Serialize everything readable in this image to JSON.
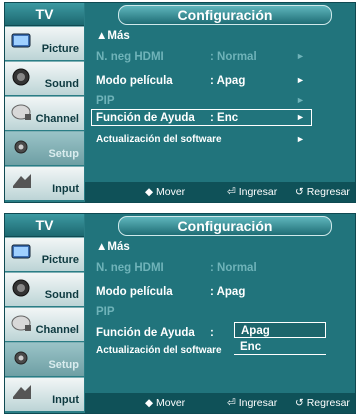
{
  "screens": [
    {
      "sidebar": {
        "header": "TV",
        "items": [
          {
            "label": "Picture",
            "dim": false
          },
          {
            "label": "Sound",
            "dim": false
          },
          {
            "label": "Channel",
            "dim": false
          },
          {
            "label": "Setup",
            "dim": true
          },
          {
            "label": "Input",
            "dim": false
          }
        ]
      },
      "title": "Configuración",
      "rows": [
        {
          "label": "▲Más",
          "value": "",
          "arrow": "",
          "disabled": false
        },
        {
          "label": "N. neg HDMI",
          "value": ": Normal",
          "arrow": "►",
          "disabled": true
        },
        {
          "label": "Modo película",
          "value": ": Apag",
          "arrow": "►",
          "disabled": false
        },
        {
          "label": "PIP",
          "value": "",
          "arrow": "►",
          "disabled": true
        },
        {
          "label": "Función de Ayuda",
          "value": ": Enc",
          "arrow": "►",
          "disabled": false
        },
        {
          "label": "Actualización del software",
          "value": "",
          "arrow": "►",
          "disabled": false
        }
      ],
      "footer": {
        "move": "◆ Mover",
        "enter": "⏎ Ingresar",
        "return": "↺ Regresar"
      }
    },
    {
      "sidebar": {
        "header": "TV",
        "items": [
          {
            "label": "Picture",
            "dim": false
          },
          {
            "label": "Sound",
            "dim": false
          },
          {
            "label": "Channel",
            "dim": false
          },
          {
            "label": "Setup",
            "dim": true
          },
          {
            "label": "Input",
            "dim": false
          }
        ]
      },
      "title": "Configuración",
      "rows": [
        {
          "label": "▲Más",
          "value": "",
          "arrow": "",
          "disabled": false
        },
        {
          "label": "N. neg HDMI",
          "value": ": Normal",
          "arrow": "",
          "disabled": true
        },
        {
          "label": "Modo película",
          "value": ": Apag",
          "arrow": "",
          "disabled": false
        },
        {
          "label": "PIP",
          "value": "",
          "arrow": "",
          "disabled": true
        },
        {
          "label": "Función de Ayuda",
          "value": ":",
          "arrow": "",
          "disabled": false
        },
        {
          "label": "Actualización del software",
          "value": "",
          "arrow": "",
          "disabled": false
        }
      ],
      "popup": {
        "options": [
          "Apag",
          "Enc"
        ],
        "selected": "Apag"
      },
      "footer": {
        "move": "◆ Mover",
        "enter": "⏎ Ingresar",
        "return": "↺ Regresar"
      }
    }
  ],
  "colors": {
    "accent": "#2a7d85",
    "panel": "#21747c",
    "footer": "#0f5158",
    "dimText": "#6fb3b9"
  }
}
